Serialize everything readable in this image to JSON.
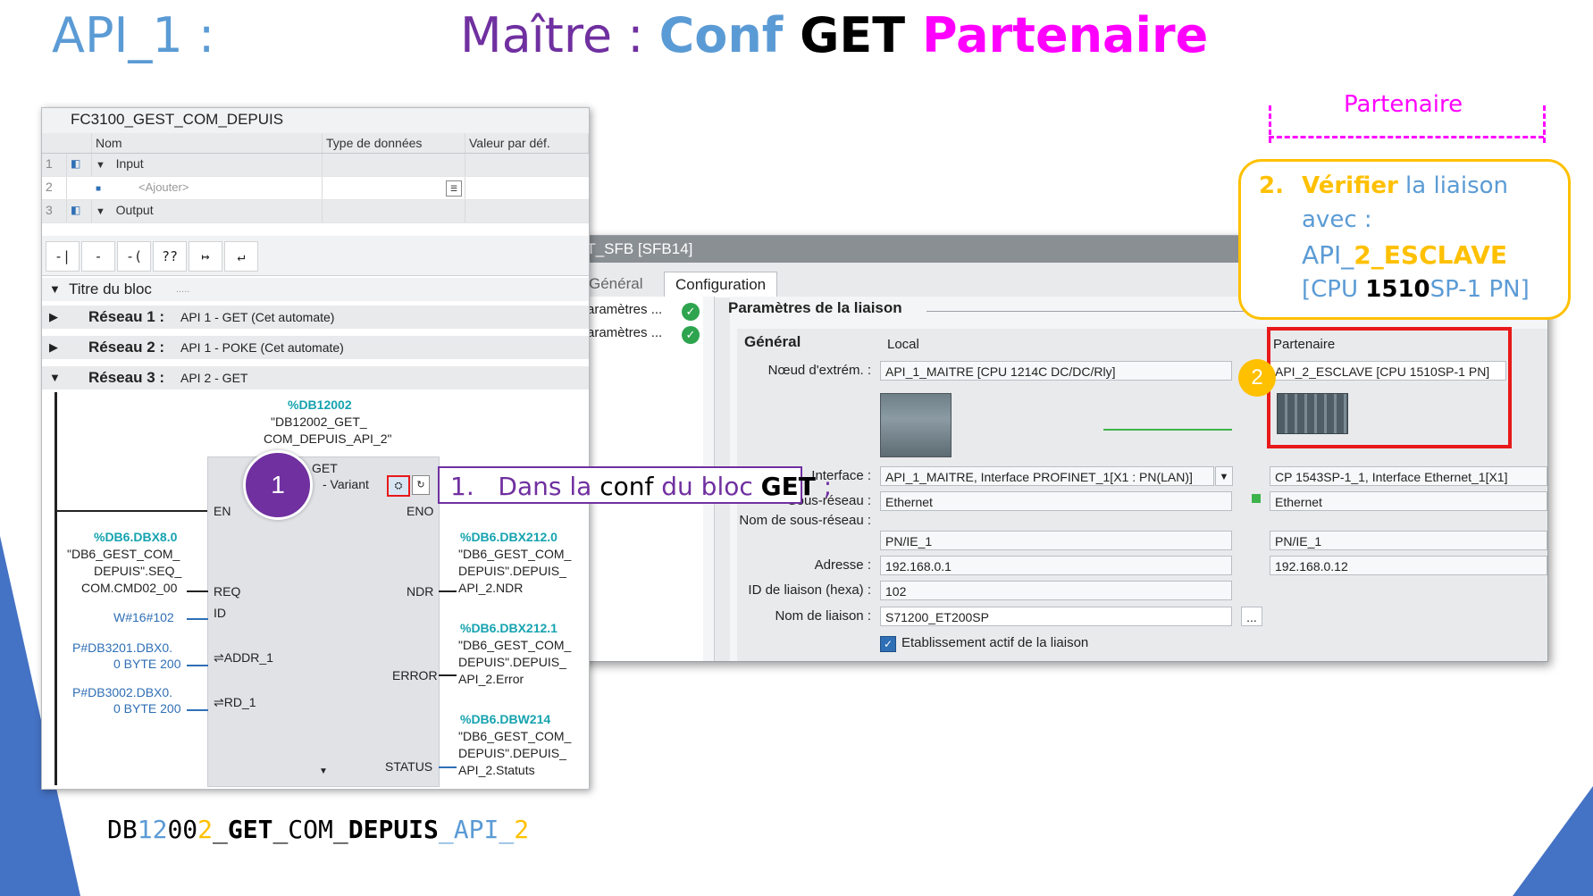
{
  "slide": {
    "title_left": "API_1 :",
    "title": {
      "part1": "Maître : ",
      "part2": "Conf ",
      "part3": "GET ",
      "part4": "Partenaire"
    },
    "bottom_name": {
      "p1": "DB",
      "p2": "12",
      "p3": "00",
      "p4": "2",
      "p5": "_",
      "p6": "GET",
      "p7": "_COM_",
      "p8": "DEPUIS",
      "p9": "_API_",
      "p10": "2"
    },
    "partenaire_label": "Partenaire",
    "colors": {
      "blue": "#5b9bd5",
      "purple": "#7030a0",
      "magenta": "#ff00ff",
      "gold": "#ffc000",
      "red": "#e8191a"
    }
  },
  "block": {
    "title": "FC3100_GEST_COM_DEPUIS",
    "columns": [
      "Nom",
      "Type de données",
      "Valeur par déf."
    ],
    "rows": [
      {
        "num": "1",
        "name": "Input"
      },
      {
        "num": "2",
        "name": "<Ajouter>"
      },
      {
        "num": "3",
        "name": "Output"
      }
    ],
    "toolbar": [
      "-| |-",
      "-|/|-",
      "-( )-",
      "??",
      "↦",
      "↵"
    ],
    "block_title_label": "Titre du bloc",
    "block_title_dots": ".....",
    "networks": [
      {
        "label": "Réseau 1 :",
        "comment": "API 1 - GET (Cet automate)"
      },
      {
        "label": "Réseau 2 :",
        "comment": "API 1 - POKE (Cet automate)"
      },
      {
        "label": "Réseau 3 :",
        "comment": "API 2 - GET"
      }
    ]
  },
  "fb": {
    "instance_addr": "%DB12002",
    "instance_name1": "\"DB12002_GET_",
    "instance_name2": "COM_DEPUIS_API_2\"",
    "type": "GET",
    "variant": "- Variant",
    "en": "EN",
    "eno": "ENO",
    "req": "REQ",
    "id": "ID",
    "addr": "⇌ADDR_1",
    "rd": "⇌RD_1",
    "ndr": "NDR",
    "error": "ERROR",
    "status": "STATUS",
    "in_req": {
      "addr": "%DB6.DBX8.0",
      "l1": "\"DB6_GEST_COM_",
      "l2": "DEPUIS\".SEQ_",
      "l3": "COM.CMD02_00"
    },
    "in_id": "W#16#102",
    "in_addr": {
      "l1": "P#DB3201.DBX0.",
      "l2": "0 BYTE 200"
    },
    "in_rd": {
      "l1": "P#DB3002.DBX0.",
      "l2": "0 BYTE 200"
    },
    "out_ndr": {
      "addr": "%DB6.DBX212.0",
      "l1": "\"DB6_GEST_COM_",
      "l2": "DEPUIS\".DEPUIS_",
      "l3": "API_2.NDR"
    },
    "out_error": {
      "addr": "%DB6.DBX212.1",
      "l1": "\"DB6_GEST_COM_",
      "l2": "DEPUIS\".DEPUIS_",
      "l3": "API_2.Error"
    },
    "out_status": {
      "addr": "%DB6.DBW214",
      "l1": "\"DB6_GEST_COM_",
      "l2": "DEPUIS\".DEPUIS_",
      "l3": "API_2.Statuts"
    }
  },
  "callout1": {
    "num": "1.",
    "t1": "Dans la ",
    "t2": "conf",
    "t3": " du bloc ",
    "t4": "GET",
    "t5": " ;"
  },
  "badge1": "1",
  "callout2": {
    "num": "2.",
    "w1": "Vérifier",
    "w2": " la liaison",
    "line2": "avec :",
    "api_a": "API_",
    "api_b": "2",
    "api_c": "_ESCLAVE",
    "cpu_a": "[CPU ",
    "cpu_b": "1510",
    "cpu_c": "SP-1 PN]"
  },
  "badge2": "2",
  "config": {
    "window_title": "ET_SFB [SFB14]",
    "tab_general": "Général",
    "tab_config": "Configuration",
    "nav": [
      "Paramètres ...",
      "Paramètres ..."
    ],
    "section_title": "Paramètres de la liaison",
    "sub_title": "Général",
    "col_local": "Local",
    "col_partner": "Partenaire",
    "labels": {
      "node": "Nœud d'extrém. :",
      "interface": "Interface :",
      "subnet": "Sous-réseau :",
      "subnet_name": "Nom de sous-réseau :",
      "address": "Adresse :",
      "conn_id": "ID de liaison (hexa) :",
      "conn_name": "Nom de liaison :",
      "active": "Etablissement actif de la liaison"
    },
    "local": {
      "node": "API_1_MAITRE [CPU 1214C DC/DC/Rly]",
      "interface": "API_1_MAITRE, Interface PROFINET_1[X1 : PN(LAN)]",
      "subnet": "Ethernet",
      "subnet_name": "PN/IE_1",
      "address": "192.168.0.1",
      "conn_id": "102",
      "conn_name": "S71200_ET200SP"
    },
    "partner": {
      "node": "API_2_ESCLAVE [CPU 1510SP-1 PN]",
      "interface": "CP 1543SP-1_1, Interface Ethernet_1[X1]",
      "subnet": "Ethernet",
      "subnet_name": "PN/IE_1",
      "address": "192.168.0.12"
    },
    "browse": "..."
  }
}
